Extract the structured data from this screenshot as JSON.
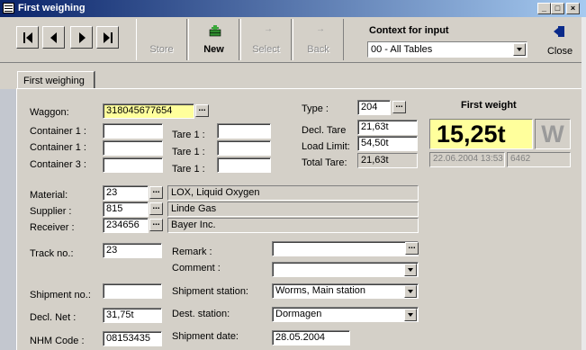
{
  "window": {
    "title": "First weighing"
  },
  "toolbar": {
    "store": "Store",
    "new": "New",
    "select": "Select",
    "back": "Back",
    "context_label": "Context for input",
    "context_value": "00 - All Tables",
    "close": "Close"
  },
  "tabs": {
    "first": "First weighing"
  },
  "form": {
    "waggon_label": "Waggon:",
    "waggon_value": "318045677654",
    "container1_label": "Container 1 :",
    "container2_label": "Container 1 :",
    "container3_label": "Container 3 :",
    "tare1_label": "Tare 1 :",
    "tare2_label": "Tare 1 :",
    "tare3_label": "Tare 1 :",
    "type_label": "Type :",
    "type_value": "204",
    "decl_tare_label": "Decl. Tare",
    "decl_tare_value": "21,63t",
    "load_limit_label": "Load Limit:",
    "load_limit_value": "54,50t",
    "total_tare_label": "Total Tare:",
    "total_tare_value": "21,63t",
    "first_weight_label": "First weight",
    "first_weight_value": "15,25t",
    "first_weight_unit": "W",
    "weigh_datetime": "22.06.2004 13:53",
    "weigh_id": "6462",
    "material_label": "Material:",
    "material_code": "23",
    "material_name": "LOX, Liquid Oxygen",
    "supplier_label": "Supplier :",
    "supplier_code": "815",
    "supplier_name": "Linde Gas",
    "receiver_label": "Receiver :",
    "receiver_code": "234656",
    "receiver_name": "Bayer Inc.",
    "track_label": "Track no.:",
    "track_value": "23",
    "remark_label": "Remark :",
    "comment_label": "Comment :",
    "shipment_no_label": "Shipment no.:",
    "shipment_station_label": "Shipment station:",
    "shipment_station_value": "Worms,  Main station",
    "decl_net_label": "Decl. Net :",
    "decl_net_value": "31,75t",
    "dest_station_label": "Dest. station:",
    "dest_station_value": "Dormagen",
    "nhm_label": "NHM Code :",
    "nhm_value": "08153435",
    "shipment_date_label": "Shipment date:",
    "shipment_date_value": "28.05.2004"
  },
  "icons": {
    "first": "first-record-icon",
    "prev": "previous-record-icon",
    "next": "next-record-icon",
    "last": "last-record-icon",
    "new": "new-record-icon",
    "close": "close-door-icon"
  },
  "colors": {
    "highlight": "#ffff9c",
    "titlebar": "#0a246a",
    "face": "#d4d0c8"
  }
}
